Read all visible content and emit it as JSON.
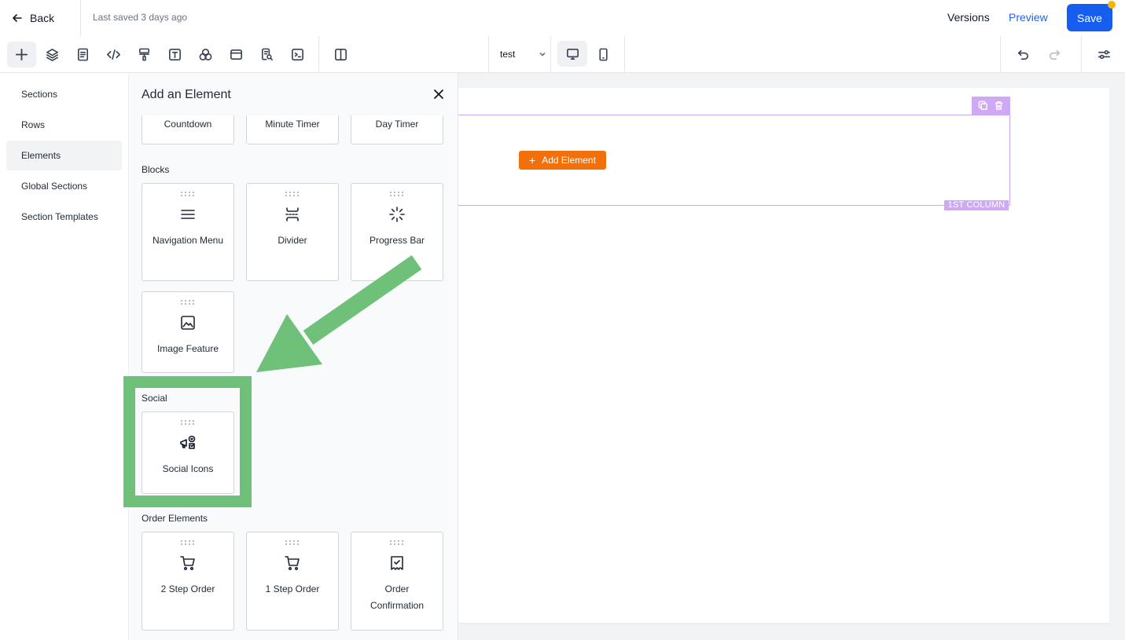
{
  "header": {
    "back_label": "Back",
    "saved_text": "Last saved 3 days ago",
    "versions_label": "Versions",
    "preview_label": "Preview",
    "save_label": "Save"
  },
  "toolbar": {
    "tools": [
      "add-icon",
      "layers-icon",
      "page-icon",
      "code-icon",
      "paint-roller-icon",
      "text-icon",
      "shapes-icon",
      "layout-icon",
      "search-doc-icon",
      "terminal-icon",
      "split-view-icon"
    ],
    "page_select_value": "test",
    "devices": [
      "desktop-icon",
      "mobile-icon"
    ],
    "right_tools": [
      "undo-icon",
      "redo-icon",
      "settings-sliders-icon"
    ]
  },
  "leftnav": {
    "items": [
      {
        "label": "Sections"
      },
      {
        "label": "Rows"
      },
      {
        "label": "Elements",
        "active": true
      },
      {
        "label": "Global Sections"
      },
      {
        "label": "Section Templates"
      }
    ]
  },
  "panel": {
    "title": "Add an Element",
    "timers": [
      "Countdown",
      "Minute Timer",
      "Day Timer"
    ],
    "blocks_label": "Blocks",
    "blocks": [
      {
        "label": "Navigation Menu",
        "icon": "menu-icon"
      },
      {
        "label": "Divider",
        "icon": "divider-icon"
      },
      {
        "label": "Progress Bar",
        "icon": "spinner-icon"
      },
      {
        "label": "Image Feature",
        "icon": "image-icon"
      }
    ],
    "social_label": "Social",
    "social": [
      {
        "label": "Social Icons",
        "icon": "megaphone-icon"
      }
    ],
    "order_label": "Order Elements",
    "order": [
      {
        "label": "2 Step Order",
        "icon": "cart-icon"
      },
      {
        "label": "1 Step Order",
        "icon": "cart-icon"
      },
      {
        "label": "Order Confirmation",
        "icon": "receipt-check-icon"
      }
    ]
  },
  "canvas": {
    "add_element_label": "Add Element",
    "column_label": "1ST COLUMN"
  },
  "colors": {
    "primary": "#155eef",
    "accent_orange": "#f2700c",
    "column_purple": "#cfa9f3",
    "annotation_green": "#6fc17a"
  }
}
